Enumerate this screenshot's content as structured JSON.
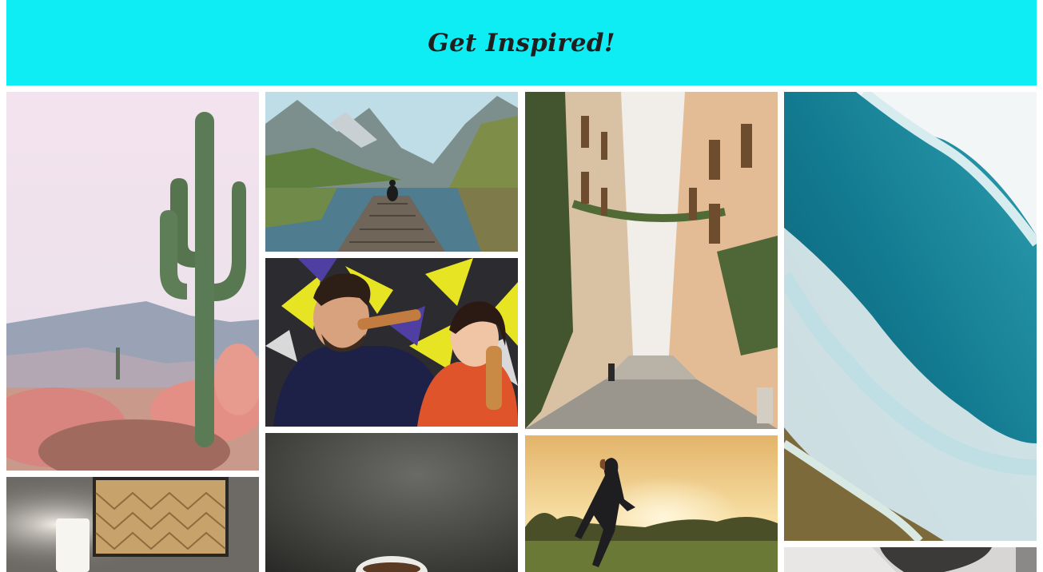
{
  "header": {
    "title": "Get Inspired!"
  },
  "gallery": {
    "photos": [
      {
        "id": "cactus",
        "subject": "saguaro-cactus-desert"
      },
      {
        "id": "lake-dock",
        "subject": "person-on-dock-mountain-lake"
      },
      {
        "id": "friends",
        "subject": "couple-drinking-graffiti-wall"
      },
      {
        "id": "street",
        "subject": "narrow-european-street"
      },
      {
        "id": "ocean",
        "subject": "aerial-ocean-waves"
      },
      {
        "id": "lamp",
        "subject": "lamp-and-wall-art"
      },
      {
        "id": "coffee",
        "subject": "coffee-cup-dark"
      },
      {
        "id": "runner",
        "subject": "runner-at-sunset"
      },
      {
        "id": "portrait",
        "subject": "person-portrait"
      }
    ]
  },
  "colors": {
    "header_bg": "#0eedf3",
    "title_text": "#1f1f1f"
  }
}
